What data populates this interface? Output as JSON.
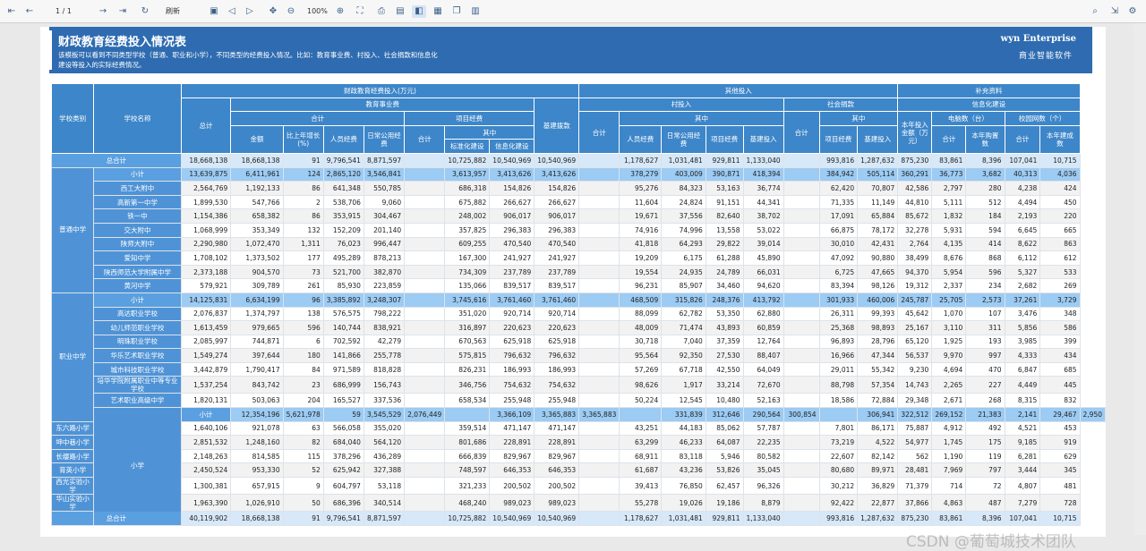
{
  "toolbar": {
    "page_indicator": "1 / 1",
    "refresh_label": "刷新",
    "zoom_level": "100%",
    "icons": [
      "first-page-icon",
      "prev-page-icon",
      "next-page-icon",
      "last-page-icon",
      "refresh-icon",
      "copy-icon",
      "prev-icon",
      "next-icon",
      "move-icon",
      "zoom-out-icon",
      "zoom-in-icon",
      "fit-icon",
      "print-icon",
      "image-icon",
      "layout-icon",
      "export-icon",
      "book-icon",
      "page-icon",
      "search-icon",
      "exit-icon",
      "settings-icon"
    ]
  },
  "report": {
    "title": "财政教育经费投入情况表",
    "description": "该模板可以看到不同类型学校（普通、职业和小学），不同类型的经费投入情况。比如：教育事业费、村投入、社会捐款和信息化建设等投入的实际经费情况。",
    "logo_text": "wyn Enterprise",
    "logo_sub": "商业智能软件",
    "watermark": "CSDN @葡萄城技术团队"
  },
  "headers": {
    "school_type": "学校类别",
    "school_name": "学校名称",
    "finance": "财政教育经费投入(万元)",
    "edu_business": "教育事业费",
    "total": "总计",
    "sum": "合计",
    "amount": "金额",
    "growth": "比上年增长(%)",
    "personnel": "人员经费",
    "public": "日常公用经费",
    "project": "项目经费",
    "among": "其中",
    "standard": "标准化建设",
    "it_build": "信息化建设",
    "infra": "基建拨款",
    "other": "其他投入",
    "village": "村投入",
    "village_infra": "基建投入",
    "donation": "社会捐款",
    "supplement": "补充资料",
    "info": "信息化建设",
    "year_input": "本年投入金额（万元）",
    "computers": "电脑数（台）",
    "year_buy": "本年购置数",
    "campus_net": "校园网数（个）",
    "year_built": "本年建成数"
  },
  "rows": [
    {
      "type": "total",
      "label": "总合计",
      "v": [
        "18,668,138",
        "18,668,138",
        "91",
        "9,796,541",
        "8,871,597",
        "",
        "10,725,882",
        "10,540,969",
        "10,540,969",
        "",
        "1,178,627",
        "1,031,481",
        "929,811",
        "1,133,040",
        "",
        "993,816",
        "1,287,632",
        "875,230",
        "83,861",
        "8,396",
        "107,041",
        "10,715"
      ]
    },
    {
      "type": "sub",
      "cat": "普通中学",
      "rowspan": 9,
      "label": "小计",
      "v": [
        "13,639,875",
        "6,411,961",
        "124",
        "2,865,120",
        "3,546,841",
        "",
        "3,613,957",
        "3,413,626",
        "3,413,626",
        "",
        "378,279",
        "403,009",
        "390,871",
        "418,394",
        "",
        "384,942",
        "505,114",
        "360,291",
        "36,773",
        "3,682",
        "40,313",
        "4,036"
      ]
    },
    {
      "type": "row",
      "label": "西工大附中",
      "v": [
        "2,564,769",
        "1,192,133",
        "86",
        "641,348",
        "550,785",
        "",
        "686,318",
        "154,826",
        "154,826",
        "",
        "95,276",
        "84,323",
        "53,163",
        "36,774",
        "",
        "62,420",
        "70,807",
        "42,586",
        "2,797",
        "280",
        "4,238",
        "424"
      ]
    },
    {
      "type": "row",
      "label": "高新第一中学",
      "v": [
        "1,899,530",
        "547,766",
        "2",
        "538,706",
        "9,060",
        "",
        "675,882",
        "266,627",
        "266,627",
        "",
        "11,604",
        "24,824",
        "91,151",
        "44,341",
        "",
        "71,335",
        "11,149",
        "44,810",
        "5,111",
        "512",
        "4,494",
        "450"
      ]
    },
    {
      "type": "row",
      "label": "铁一中",
      "v": [
        "1,154,386",
        "658,382",
        "86",
        "353,915",
        "304,467",
        "",
        "248,002",
        "906,017",
        "906,017",
        "",
        "19,671",
        "37,556",
        "82,640",
        "38,702",
        "",
        "17,091",
        "65,884",
        "85,672",
        "1,832",
        "184",
        "2,193",
        "220"
      ]
    },
    {
      "type": "row",
      "label": "交大附中",
      "v": [
        "1,068,999",
        "353,349",
        "132",
        "152,209",
        "201,140",
        "",
        "357,825",
        "296,383",
        "296,383",
        "",
        "74,916",
        "74,996",
        "13,558",
        "53,022",
        "",
        "66,875",
        "78,172",
        "32,278",
        "5,931",
        "594",
        "6,645",
        "665"
      ]
    },
    {
      "type": "row",
      "label": "陕师大附中",
      "v": [
        "2,290,980",
        "1,072,470",
        "1,311",
        "76,023",
        "996,447",
        "",
        "609,255",
        "470,540",
        "470,540",
        "",
        "41,818",
        "64,293",
        "29,822",
        "39,014",
        "",
        "30,010",
        "42,431",
        "2,764",
        "4,135",
        "414",
        "8,622",
        "863"
      ]
    },
    {
      "type": "row",
      "label": "爱知中学",
      "v": [
        "1,708,102",
        "1,373,502",
        "177",
        "495,289",
        "878,213",
        "",
        "167,300",
        "241,927",
        "241,927",
        "",
        "19,209",
        "6,175",
        "61,288",
        "45,890",
        "",
        "47,092",
        "90,880",
        "38,499",
        "8,676",
        "868",
        "6,112",
        "612"
      ]
    },
    {
      "type": "row",
      "label": "陕西师范大学附属中学",
      "v": [
        "2,373,188",
        "904,570",
        "73",
        "521,700",
        "382,870",
        "",
        "734,309",
        "237,789",
        "237,789",
        "",
        "19,554",
        "24,935",
        "24,789",
        "66,031",
        "",
        "6,725",
        "47,665",
        "94,370",
        "5,954",
        "596",
        "5,327",
        "533"
      ]
    },
    {
      "type": "row",
      "label": "黄河中学",
      "v": [
        "579,921",
        "309,789",
        "261",
        "85,930",
        "223,859",
        "",
        "135,066",
        "839,517",
        "839,517",
        "",
        "96,231",
        "85,907",
        "34,460",
        "94,620",
        "",
        "83,394",
        "98,126",
        "19,312",
        "2,337",
        "234",
        "2,682",
        "269"
      ]
    },
    {
      "type": "sub",
      "cat": "职业中学",
      "rowspan": 9,
      "label": "小计",
      "v": [
        "14,125,831",
        "6,634,199",
        "96",
        "3,385,892",
        "3,248,307",
        "",
        "3,745,616",
        "3,761,460",
        "3,761,460",
        "",
        "468,509",
        "315,826",
        "248,376",
        "413,792",
        "",
        "301,933",
        "460,006",
        "245,787",
        "25,705",
        "2,573",
        "37,261",
        "3,729"
      ]
    },
    {
      "type": "row",
      "label": "高达职业学校",
      "v": [
        "2,076,837",
        "1,374,797",
        "138",
        "576,575",
        "798,222",
        "",
        "351,020",
        "920,714",
        "920,714",
        "",
        "88,099",
        "62,782",
        "53,350",
        "62,880",
        "",
        "26,311",
        "99,393",
        "45,642",
        "1,070",
        "107",
        "3,476",
        "348"
      ]
    },
    {
      "type": "row",
      "label": "幼儿师范职业学校",
      "v": [
        "1,613,459",
        "979,665",
        "596",
        "140,744",
        "838,921",
        "",
        "316,897",
        "220,623",
        "220,623",
        "",
        "48,009",
        "71,474",
        "43,893",
        "60,859",
        "",
        "25,368",
        "98,893",
        "25,167",
        "3,110",
        "311",
        "5,856",
        "586"
      ]
    },
    {
      "type": "row",
      "label": "明珠职业学校",
      "v": [
        "2,085,997",
        "744,871",
        "6",
        "702,592",
        "42,279",
        "",
        "670,563",
        "625,918",
        "625,918",
        "",
        "30,718",
        "7,040",
        "37,359",
        "12,764",
        "",
        "96,893",
        "28,796",
        "65,120",
        "1,925",
        "193",
        "3,985",
        "399"
      ]
    },
    {
      "type": "row",
      "label": "华乐艺术职业学校",
      "v": [
        "1,549,274",
        "397,644",
        "180",
        "141,866",
        "255,778",
        "",
        "575,815",
        "796,632",
        "796,632",
        "",
        "95,564",
        "92,350",
        "27,530",
        "88,407",
        "",
        "16,966",
        "47,344",
        "56,537",
        "9,970",
        "997",
        "4,333",
        "434"
      ]
    },
    {
      "type": "row",
      "label": "城市科技职业学校",
      "v": [
        "3,442,879",
        "1,790,417",
        "84",
        "971,589",
        "818,828",
        "",
        "826,231",
        "186,993",
        "186,993",
        "",
        "57,269",
        "67,718",
        "42,550",
        "64,049",
        "",
        "29,011",
        "55,342",
        "9,230",
        "4,694",
        "470",
        "6,847",
        "685"
      ]
    },
    {
      "type": "row",
      "label": "培华学院附属职业中等专业学校",
      "v": [
        "1,537,254",
        "843,742",
        "23",
        "686,999",
        "156,743",
        "",
        "346,756",
        "754,632",
        "754,632",
        "",
        "98,626",
        "1,917",
        "33,214",
        "72,670",
        "",
        "88,798",
        "57,354",
        "14,743",
        "2,265",
        "227",
        "4,449",
        "445"
      ]
    },
    {
      "type": "row",
      "label": "艺术职业高级中学",
      "v": [
        "1,820,131",
        "503,063",
        "204",
        "165,527",
        "337,536",
        "",
        "658,534",
        "255,948",
        "255,948",
        "",
        "50,224",
        "12,545",
        "10,480",
        "52,163",
        "",
        "18,586",
        "72,884",
        "29,348",
        "2,671",
        "268",
        "8,315",
        "832"
      ]
    },
    {
      "type": "sub",
      "cat": "小学",
      "rowspan": 8,
      "label": "小计",
      "v": [
        "12,354,196",
        "5,621,978",
        "59",
        "3,545,529",
        "2,076,449",
        "",
        "3,366,109",
        "3,365,883",
        "3,365,883",
        "",
        "331,839",
        "312,646",
        "290,564",
        "300,854",
        "",
        "306,941",
        "322,512",
        "269,152",
        "21,383",
        "2,141",
        "29,467",
        "2,950"
      ]
    },
    {
      "type": "row",
      "label": "东六路小学",
      "v": [
        "1,640,106",
        "921,078",
        "63",
        "566,058",
        "355,020",
        "",
        "359,514",
        "471,147",
        "471,147",
        "",
        "43,251",
        "44,183",
        "85,062",
        "57,787",
        "",
        "7,801",
        "86,171",
        "75,887",
        "4,912",
        "492",
        "4,521",
        "453"
      ]
    },
    {
      "type": "row",
      "label": "坤中巷小学",
      "v": [
        "2,851,532",
        "1,248,160",
        "82",
        "684,040",
        "564,120",
        "",
        "801,686",
        "228,891",
        "228,891",
        "",
        "63,299",
        "46,233",
        "64,087",
        "22,235",
        "",
        "73,219",
        "4,522",
        "54,977",
        "1,745",
        "175",
        "9,185",
        "919"
      ]
    },
    {
      "type": "row",
      "label": "长缨路小学",
      "v": [
        "2,148,263",
        "814,585",
        "115",
        "378,296",
        "436,289",
        "",
        "666,839",
        "829,967",
        "829,967",
        "",
        "68,911",
        "83,118",
        "5,946",
        "80,582",
        "",
        "22,607",
        "82,142",
        "562",
        "1,190",
        "119",
        "6,281",
        "629"
      ]
    },
    {
      "type": "row",
      "label": "育英小学",
      "v": [
        "2,450,524",
        "953,330",
        "52",
        "625,942",
        "327,388",
        "",
        "748,597",
        "646,353",
        "646,353",
        "",
        "61,687",
        "43,236",
        "53,826",
        "35,045",
        "",
        "80,680",
        "89,971",
        "28,481",
        "7,969",
        "797",
        "3,444",
        "345"
      ]
    },
    {
      "type": "row",
      "label": "西光实验小学",
      "v": [
        "1,300,381",
        "657,915",
        "9",
        "604,797",
        "53,118",
        "",
        "321,233",
        "200,502",
        "200,502",
        "",
        "39,413",
        "76,850",
        "62,457",
        "96,326",
        "",
        "30,212",
        "36,829",
        "71,379",
        "714",
        "72",
        "4,807",
        "481"
      ]
    },
    {
      "type": "row",
      "label": "华山实验小学",
      "v": [
        "1,963,390",
        "1,026,910",
        "50",
        "686,396",
        "340,514",
        "",
        "468,240",
        "989,023",
        "989,023",
        "",
        "55,278",
        "19,026",
        "19,186",
        "8,879",
        "",
        "92,422",
        "22,877",
        "37,866",
        "4,863",
        "487",
        "7,279",
        "728"
      ]
    },
    {
      "type": "total",
      "label": "总合计",
      "v": [
        "40,119,902",
        "18,668,138",
        "91",
        "9,796,541",
        "8,871,597",
        "",
        "10,725,882",
        "10,540,969",
        "10,540,969",
        "",
        "1,178,627",
        "1,031,481",
        "929,811",
        "1,133,040",
        "",
        "993,816",
        "1,287,632",
        "875,230",
        "83,861",
        "8,396",
        "107,041",
        "10,715"
      ]
    }
  ]
}
